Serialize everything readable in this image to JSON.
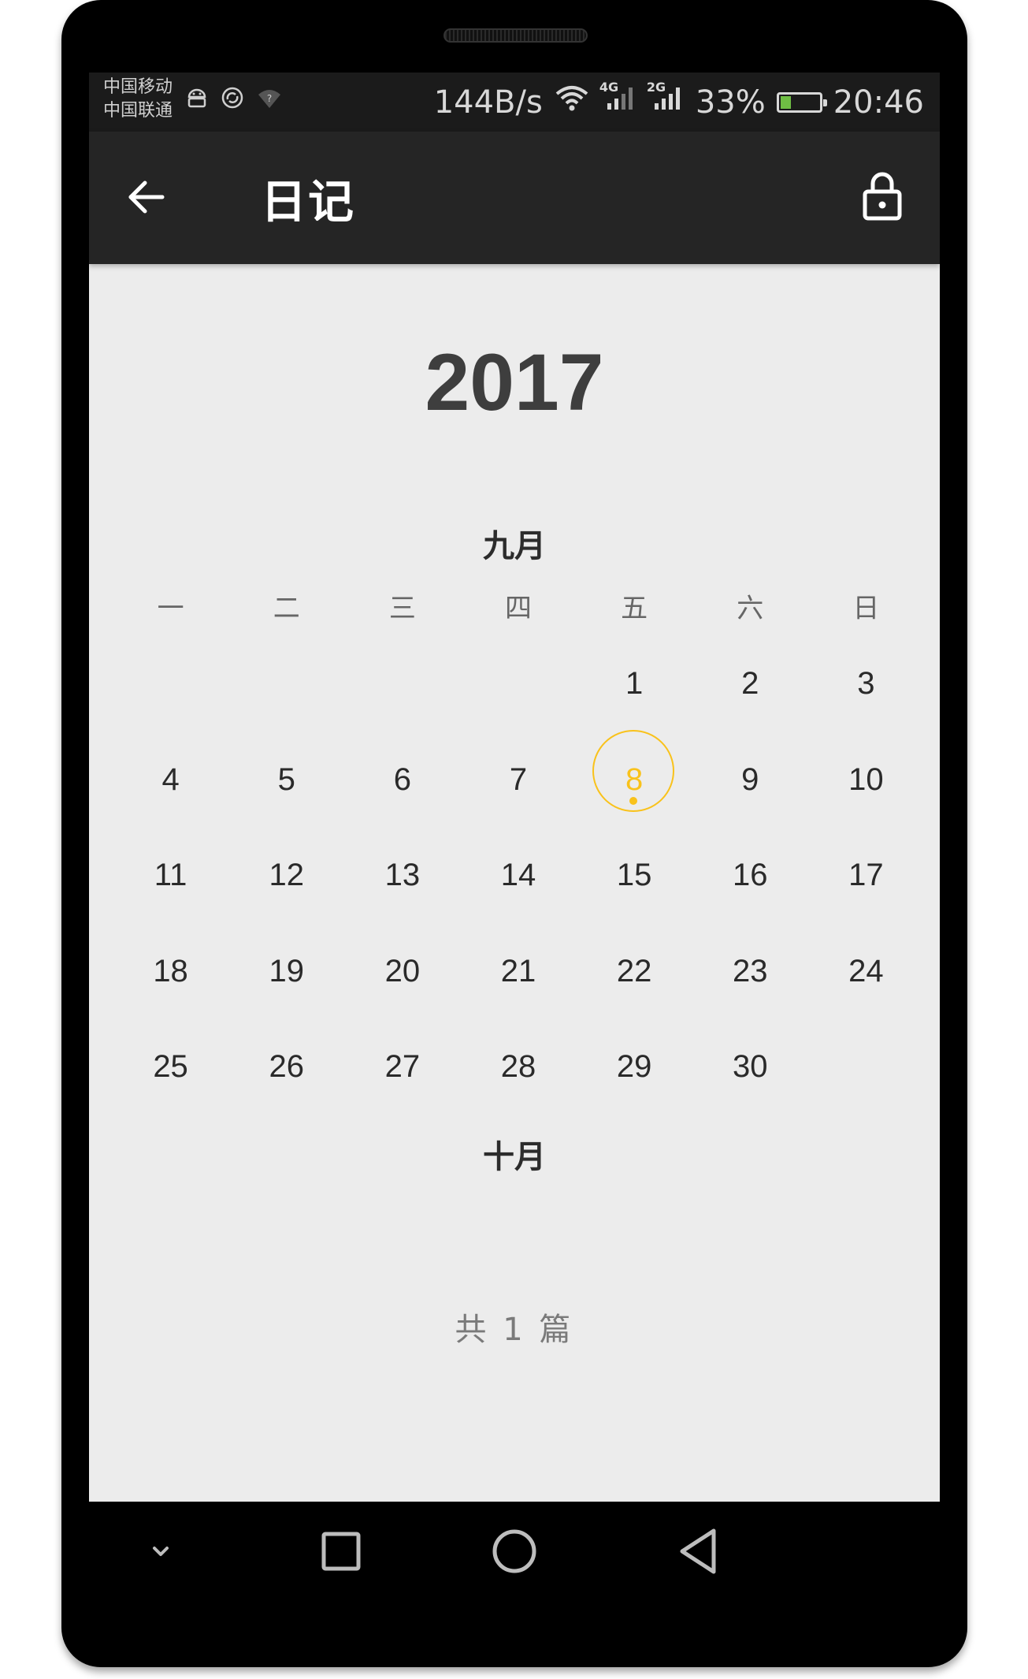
{
  "status_bar": {
    "carrier_1": "中国移动",
    "carrier_2": "中国联通",
    "net_speed": "144B/s",
    "net_tag_1": "4G",
    "net_tag_2": "2G",
    "battery_percent": "33%",
    "battery_level": 0.33,
    "time": "20:46",
    "icons": [
      "android-icon",
      "sync-icon",
      "wifi-unknown-icon",
      "wifi-icon",
      "signal-icon",
      "battery-icon"
    ]
  },
  "app_bar": {
    "title": "日记",
    "back_icon": "arrow-left-icon",
    "lock_icon": "lock-icon"
  },
  "calendar": {
    "year": "2017",
    "month": "九月",
    "weekdays": [
      "一",
      "二",
      "三",
      "四",
      "五",
      "六",
      "日"
    ],
    "weeks": [
      [
        "",
        "",
        "",
        "",
        "1",
        "2",
        "3"
      ],
      [
        "4",
        "5",
        "6",
        "7",
        "8",
        "9",
        "10"
      ],
      [
        "11",
        "12",
        "13",
        "14",
        "15",
        "16",
        "17"
      ],
      [
        "18",
        "19",
        "20",
        "21",
        "22",
        "23",
        "24"
      ],
      [
        "25",
        "26",
        "27",
        "28",
        "29",
        "30",
        ""
      ]
    ],
    "selected_day": "8",
    "next_month": "十月"
  },
  "summary": {
    "count_text": "共 1 篇"
  },
  "colors": {
    "accent": "#f9c21b",
    "app_bar_bg": "#252525",
    "status_bar_bg": "#1b1b1b",
    "content_bg": "#ececec"
  },
  "nav_bar": {
    "icons": [
      "chevron-down-icon",
      "square-recents-icon",
      "circle-home-icon",
      "triangle-back-icon"
    ]
  }
}
